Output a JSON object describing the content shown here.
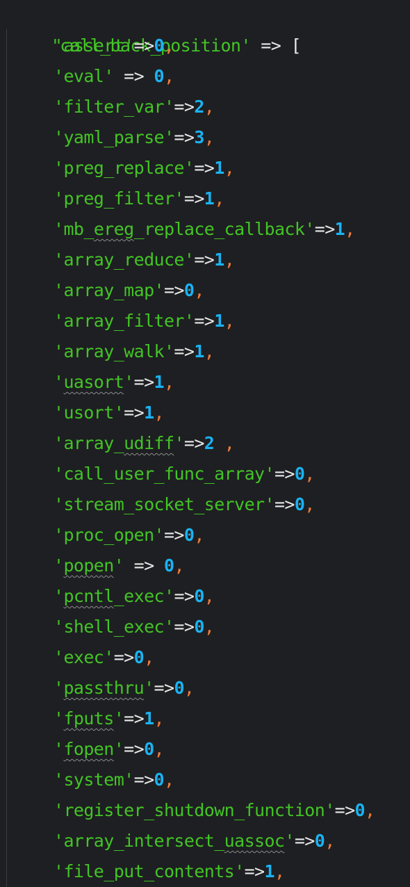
{
  "code": {
    "header": {
      "key": "'call_back_position'",
      "op": " => ["
    },
    "entries": [
      {
        "pre": "'",
        "name": "assert",
        "post": "'",
        "arrow": "=>",
        "value": "0",
        "comma": ","
      },
      {
        "pre": "'",
        "name": "eval",
        "post": "'",
        "arrow": " => ",
        "value": "0",
        "comma": ","
      },
      {
        "pre": "'",
        "name": "filter_var",
        "post": "'",
        "arrow": "=>",
        "value": "2",
        "comma": ","
      },
      {
        "pre": "'",
        "name": "yaml_parse",
        "post": "'",
        "arrow": "=>",
        "value": "3",
        "comma": ","
      },
      {
        "pre": "'",
        "name": "preg_replace",
        "post": "'",
        "arrow": "=>",
        "value": "1",
        "comma": ","
      },
      {
        "pre": "'",
        "name": "preg_filter",
        "post": "'",
        "arrow": "=>",
        "value": "1",
        "comma": ","
      },
      {
        "pre": "'mb_",
        "name": "ereg",
        "post": "_replace_callback'",
        "arrow": "=>",
        "value": "1",
        "comma": ","
      },
      {
        "pre": "'",
        "name": "array_reduce",
        "post": "'",
        "arrow": "=>",
        "value": "1",
        "comma": ","
      },
      {
        "pre": "'",
        "name": "array_map",
        "post": "'",
        "arrow": "=>",
        "value": "0",
        "comma": ","
      },
      {
        "pre": "'",
        "name": "array_filter",
        "post": "'",
        "arrow": "=>",
        "value": "1",
        "comma": ","
      },
      {
        "pre": "'",
        "name": "array_walk",
        "post": "'",
        "arrow": "=>",
        "value": "1",
        "comma": ","
      },
      {
        "pre": "'",
        "name": "uasort",
        "post": "'",
        "arrow": "=>",
        "value": "1",
        "comma": ","
      },
      {
        "pre": "'",
        "name": "usort",
        "post": "'",
        "arrow": "=>",
        "value": "1",
        "comma": ","
      },
      {
        "pre": "'array_",
        "name": "udiff",
        "post": "'",
        "arrow": "=>",
        "value": "2",
        "comma": " ,"
      },
      {
        "pre": "'",
        "name": "call_user_func_array",
        "post": "'",
        "arrow": "=>",
        "value": "0",
        "comma": ","
      },
      {
        "pre": "'",
        "name": "stream_socket_server",
        "post": "'",
        "arrow": "=>",
        "value": "0",
        "comma": ","
      },
      {
        "pre": "'",
        "name": "proc_open",
        "post": "'",
        "arrow": "=>",
        "value": "0",
        "comma": ","
      },
      {
        "pre": "'",
        "name": "popen",
        "post": "'",
        "arrow": " => ",
        "value": "0",
        "comma": ","
      },
      {
        "pre": "'",
        "name": "pcntl",
        "post": "_exec'",
        "arrow": "=>",
        "value": "0",
        "comma": ","
      },
      {
        "pre": "'",
        "name": "shell_exec",
        "post": "'",
        "arrow": "=>",
        "value": "0",
        "comma": ","
      },
      {
        "pre": "'",
        "name": "exec",
        "post": "'",
        "arrow": "=>",
        "value": "0",
        "comma": ","
      },
      {
        "pre": "'",
        "name": "passthru",
        "post": "'",
        "arrow": "=>",
        "value": "0",
        "comma": ","
      },
      {
        "pre": "'",
        "name": "fputs",
        "post": "'",
        "arrow": "=>",
        "value": "1",
        "comma": ","
      },
      {
        "pre": "'",
        "name": "fopen",
        "post": "'",
        "arrow": "=>",
        "value": "0",
        "comma": ","
      },
      {
        "pre": "'",
        "name": "system",
        "post": "'",
        "arrow": "=>",
        "value": "0",
        "comma": ","
      },
      {
        "pre": "'",
        "name": "register_shutdown_function",
        "post": "'",
        "arrow": "=>",
        "value": "0",
        "comma": ","
      },
      {
        "pre": "'array_intersect_",
        "name": "uassoc",
        "post": "'",
        "arrow": "=>",
        "value": "0",
        "comma": ","
      },
      {
        "pre": "'",
        "name": "file_put_contents",
        "post": "'",
        "arrow": "=>",
        "value": "1",
        "comma": ","
      }
    ]
  },
  "colors": {
    "background": "#1e1f22",
    "string": "#43c426",
    "operator": "#e8e8e8",
    "number": "#1ab3f3",
    "comma": "#f07d3a"
  }
}
